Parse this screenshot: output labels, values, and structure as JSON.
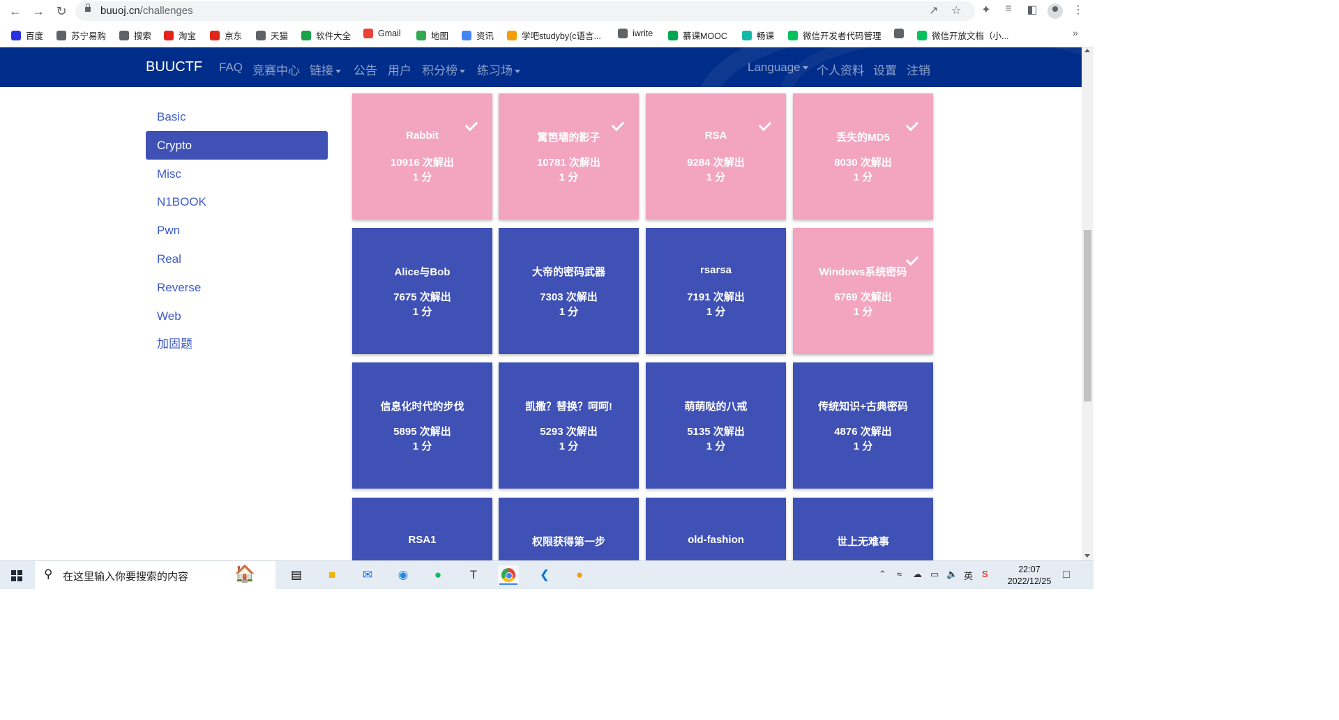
{
  "browser": {
    "url_host": "buuoj.cn",
    "url_path": "/challenges"
  },
  "bookmarks": [
    {
      "label": "百度",
      "color": "#2932e1"
    },
    {
      "label": "苏宁易购",
      "color": "#5f6368"
    },
    {
      "label": "搜索",
      "color": "#5f6368"
    },
    {
      "label": "淘宝",
      "color": "#e1251b"
    },
    {
      "label": "京东",
      "color": "#e1251b"
    },
    {
      "label": "天猫",
      "color": "#5f6368"
    },
    {
      "label": "软件大全",
      "color": "#1aa34a"
    },
    {
      "label": "Gmail",
      "color": "#ea4335"
    },
    {
      "label": "地图",
      "color": "#34a853"
    },
    {
      "label": "资讯",
      "color": "#4285f4"
    },
    {
      "label": "学吧studyby(c语言...",
      "color": "#f59e0b"
    },
    {
      "label": "iwrite",
      "color": "#5f6368"
    },
    {
      "label": "慕课MOOC",
      "color": "#00a650"
    },
    {
      "label": "畅课",
      "color": "#14b8a6"
    },
    {
      "label": "微信开发者代码管理",
      "color": "#07c160"
    },
    {
      "label": "",
      "color": "#5f6368"
    },
    {
      "label": "微信开放文档（小...",
      "color": "#07c160"
    }
  ],
  "navbar": {
    "brand": "BUUCTF",
    "left_items": [
      {
        "label": "FAQ",
        "dropdown": false
      },
      {
        "label": "竞赛中心",
        "dropdown": false
      },
      {
        "label": "链接",
        "dropdown": true
      },
      {
        "label": "公告",
        "dropdown": false
      },
      {
        "label": "用户",
        "dropdown": false
      },
      {
        "label": "积分榜",
        "dropdown": true
      },
      {
        "label": "练习场",
        "dropdown": true
      }
    ],
    "right_items": [
      {
        "label": "Language",
        "dropdown": true
      },
      {
        "label": "个人资料",
        "dropdown": false
      },
      {
        "label": "设置",
        "dropdown": false
      },
      {
        "label": "注销",
        "dropdown": false
      }
    ],
    "bg_color": "#002d8a"
  },
  "sidebar": {
    "items": [
      {
        "label": "Basic",
        "active": false
      },
      {
        "label": "Crypto",
        "active": true
      },
      {
        "label": "Misc",
        "active": false
      },
      {
        "label": "N1BOOK",
        "active": false
      },
      {
        "label": "Pwn",
        "active": false
      },
      {
        "label": "Real",
        "active": false
      },
      {
        "label": "Reverse",
        "active": false
      },
      {
        "label": "Web",
        "active": false
      },
      {
        "label": "加固题",
        "active": false
      }
    ]
  },
  "colors": {
    "solved": "#f3a5c0",
    "unsolved": "#3f51b5",
    "link": "#3d5acb"
  },
  "challenges": [
    {
      "name": "Rabbit",
      "solves": "10916 次解出",
      "points": "1 分",
      "solved": true
    },
    {
      "name": "篱笆墙的影子",
      "solves": "10781 次解出",
      "points": "1 分",
      "solved": true
    },
    {
      "name": "RSA",
      "solves": "9284 次解出",
      "points": "1 分",
      "solved": true
    },
    {
      "name": "丢失的MD5",
      "solves": "8030 次解出",
      "points": "1 分",
      "solved": true
    },
    {
      "name": "Alice与Bob",
      "solves": "7675 次解出",
      "points": "1 分",
      "solved": false
    },
    {
      "name": "大帝的密码武器",
      "solves": "7303 次解出",
      "points": "1 分",
      "solved": false
    },
    {
      "name": "rsarsa",
      "solves": "7191 次解出",
      "points": "1 分",
      "solved": false
    },
    {
      "name": "Windows系统密码",
      "solves": "6769 次解出",
      "points": "1 分",
      "solved": true
    },
    {
      "name": "信息化时代的步伐",
      "solves": "5895 次解出",
      "points": "1 分",
      "solved": false
    },
    {
      "name": "凯撒？替换？呵呵!",
      "solves": "5293 次解出",
      "points": "1 分",
      "solved": false
    },
    {
      "name": "萌萌哒的八戒",
      "solves": "5135 次解出",
      "points": "1 分",
      "solved": false
    },
    {
      "name": "传统知识+古典密码",
      "solves": "4876 次解出",
      "points": "1 分",
      "solved": false
    },
    {
      "name": "RSA1",
      "solves": "",
      "points": "",
      "solved": false
    },
    {
      "name": "权限获得第一步",
      "solves": "",
      "points": "",
      "solved": false
    },
    {
      "name": "old-fashion",
      "solves": "",
      "points": "",
      "solved": false
    },
    {
      "name": "世上无难事",
      "solves": "",
      "points": "",
      "solved": false
    }
  ],
  "taskbar": {
    "search_placeholder": "在这里输入你要搜索的内容",
    "time": "22:07",
    "date": "2022/12/25",
    "ime": "英"
  }
}
